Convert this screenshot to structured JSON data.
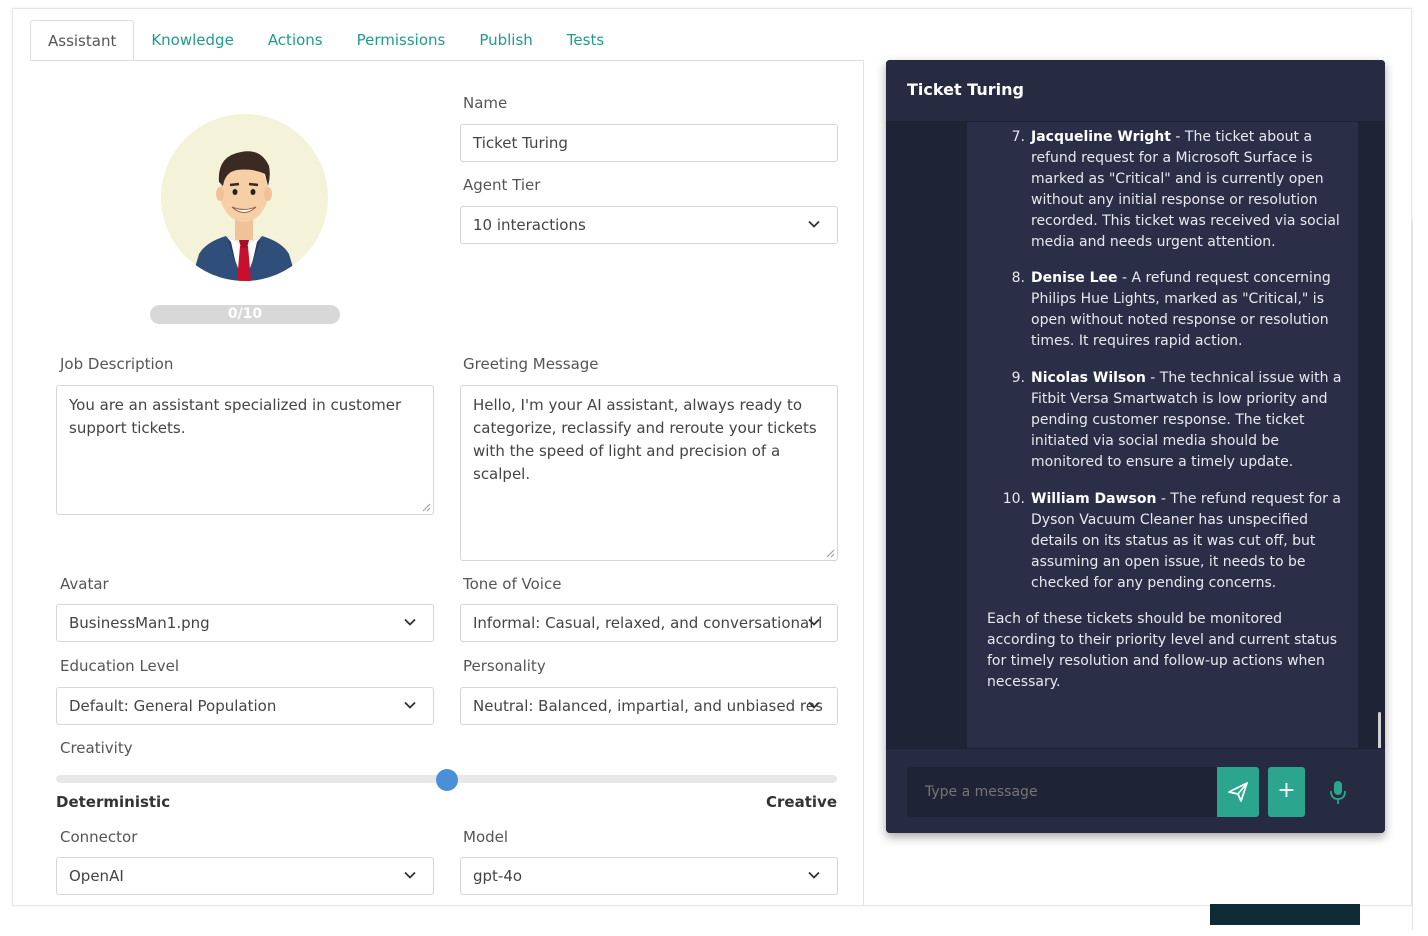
{
  "tabs": [
    "Assistant",
    "Knowledge",
    "Actions",
    "Permissions",
    "Publish",
    "Tests"
  ],
  "avatar": {
    "progress_label": "0/10"
  },
  "form": {
    "name_label": "Name",
    "name_value": "Ticket Turing",
    "tier_label": "Agent Tier",
    "tier_value": "10 interactions",
    "job_label": "Job Description",
    "job_value": "You are an assistant specialized in customer support tickets.",
    "greeting_label": "Greeting Message",
    "greeting_value": "Hello, I'm your AI assistant, always ready to categorize, reclassify and reroute your tickets with the speed of light and precision of a scalpel.",
    "avatar_label": "Avatar",
    "avatar_value": "BusinessMan1.png",
    "tone_label": "Tone of Voice",
    "tone_value": "Informal: Casual, relaxed, and conversational l",
    "education_label": "Education Level",
    "education_value": "Default: General Population",
    "personality_label": "Personality",
    "personality_value": "Neutral: Balanced, impartial, and unbiased res",
    "creativity_label": "Creativity",
    "creativity_level": 0.5,
    "slider_min_label": "Deterministic",
    "slider_max_label": "Creative",
    "connector_label": "Connector",
    "connector_value": "OpenAI",
    "model_label": "Model",
    "model_value": "gpt-4o"
  },
  "chat": {
    "title": "Ticket Turing",
    "items": [
      {
        "num": "7.",
        "name": "Jacqueline Wright",
        "text": " - The ticket about a refund request for a Microsoft Surface is marked as \"Critical\" and is currently open without any initial response or resolution recorded. This ticket was received via social media and needs urgent attention."
      },
      {
        "num": "8.",
        "name": "Denise Lee",
        "text": " - A refund request concerning Philips Hue Lights, marked as \"Critical,\" is open without noted response or resolution times. It requires rapid action."
      },
      {
        "num": "9.",
        "name": "Nicolas Wilson",
        "text": " - The technical issue with a Fitbit Versa Smartwatch is low priority and pending customer response. The ticket initiated via social media should be monitored to ensure a timely update."
      },
      {
        "num": "10.",
        "name": "William Dawson",
        "text": " - The refund request for a Dyson Vacuum Cleaner has unspecified details on its status as it was cut off, but assuming an open issue, it needs to be checked for any pending concerns."
      }
    ],
    "summary": "Each of these tickets should be monitored according to their priority level and current status for timely resolution and follow-up actions when necessary.",
    "input_placeholder": "Type a message",
    "add_label": "+"
  },
  "colors": {
    "accent": "#2ba58e",
    "tab_text": "#1f9c8a",
    "chat_bg": "#25293d",
    "slider_thumb": "#4a90d9"
  }
}
